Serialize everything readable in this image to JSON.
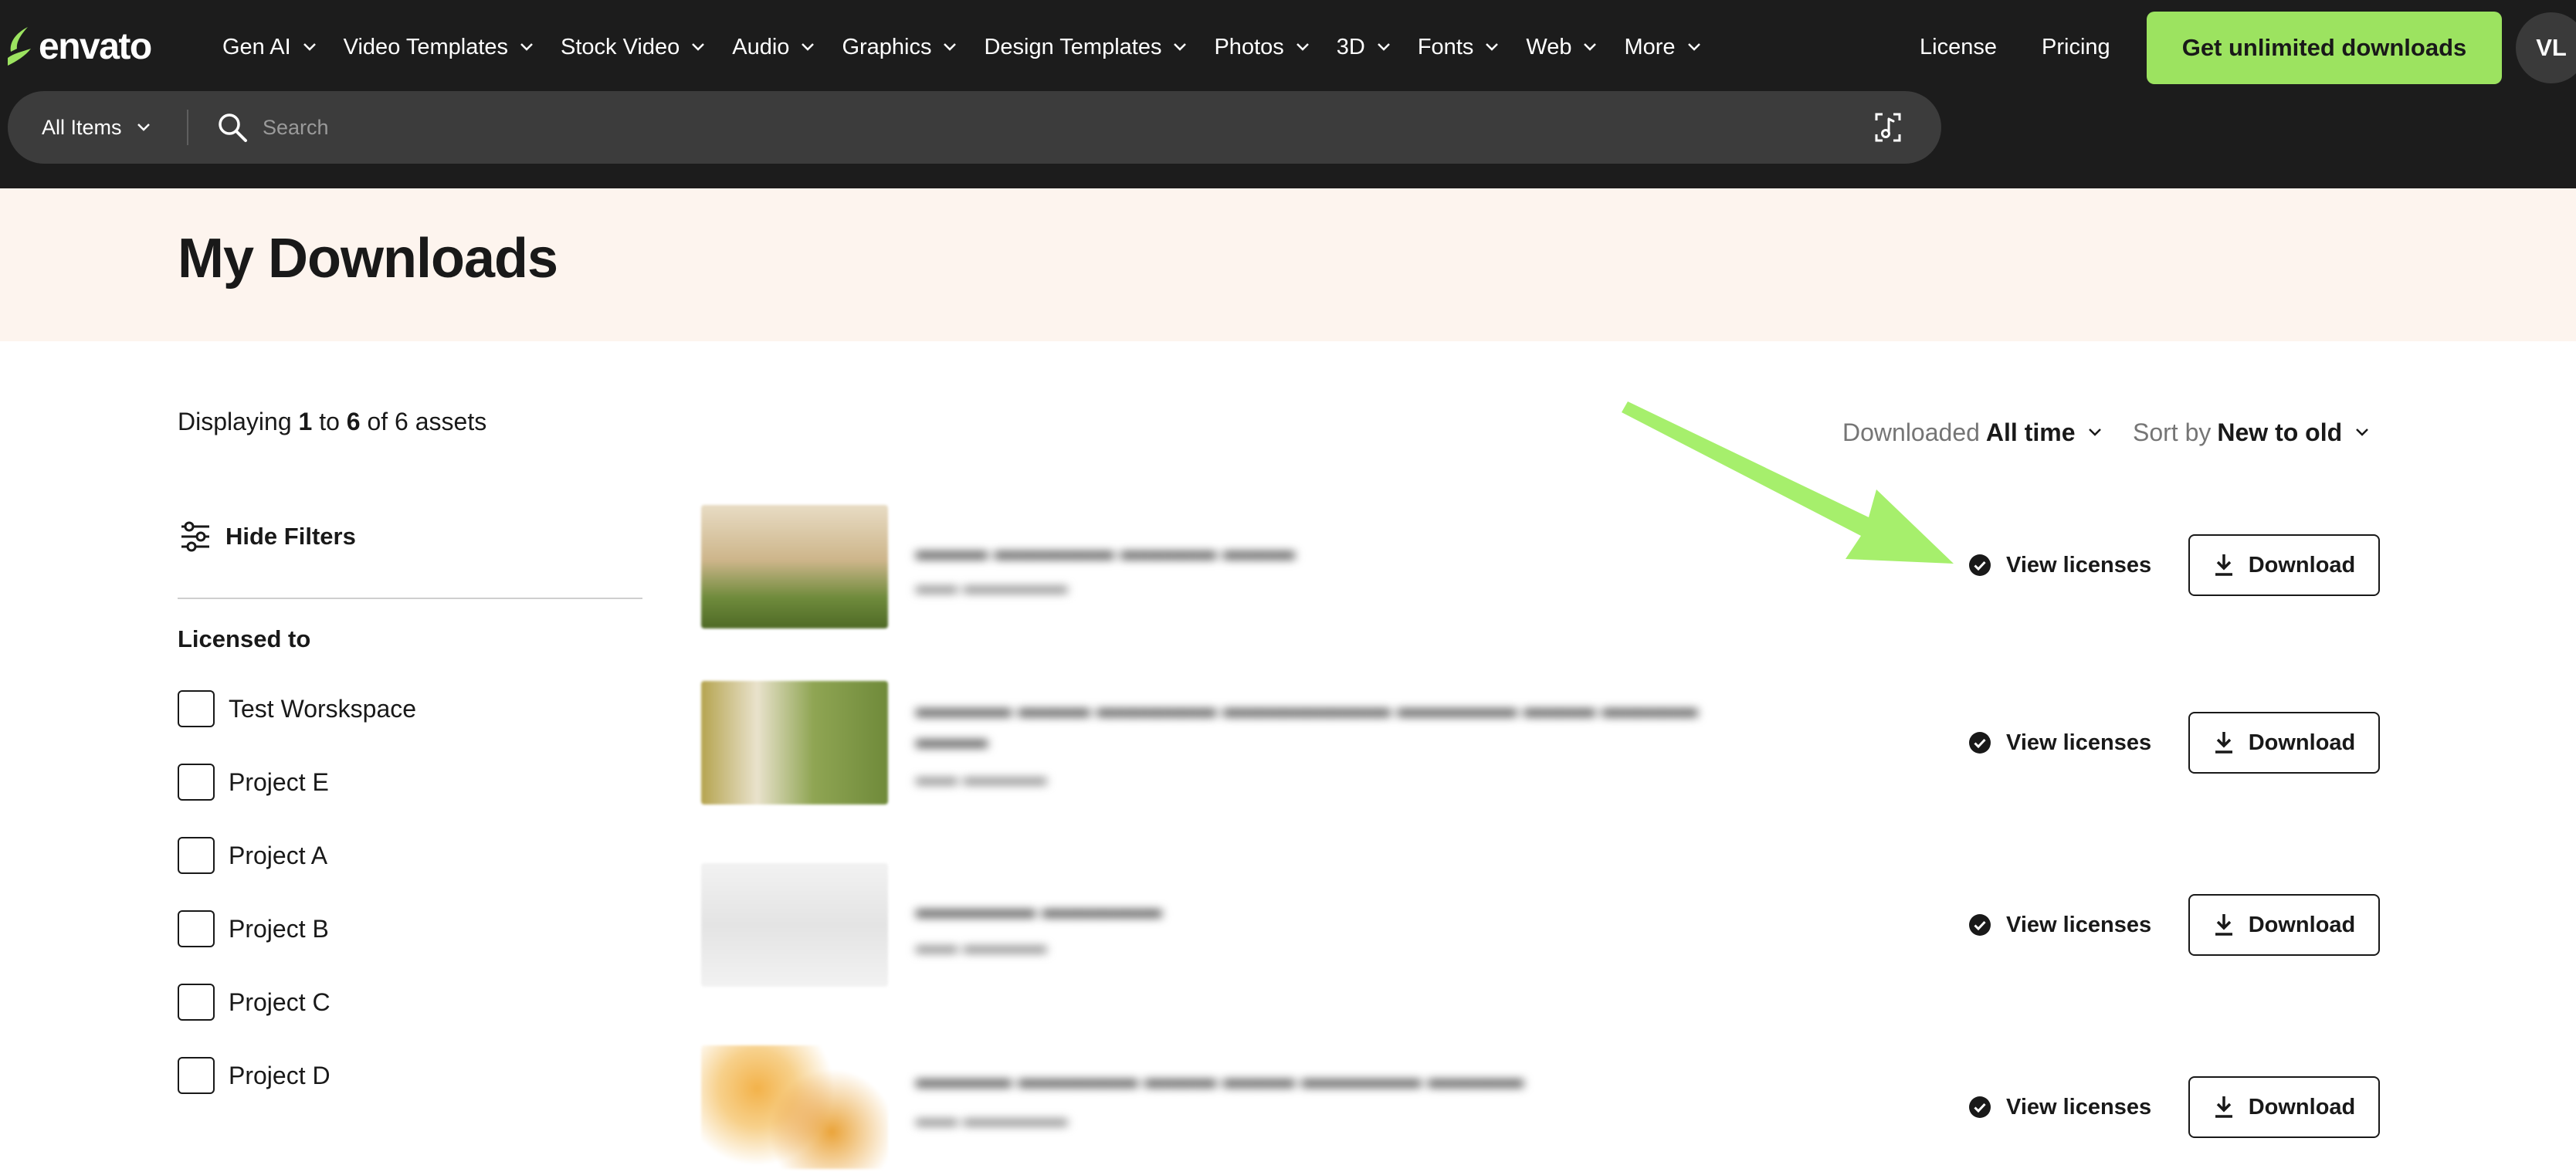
{
  "header": {
    "logo_text": "envato",
    "nav": [
      "Gen AI",
      "Video Templates",
      "Stock Video",
      "Audio",
      "Graphics",
      "Design Templates",
      "Photos",
      "3D",
      "Fonts",
      "Web",
      "More"
    ],
    "license_link": "License",
    "pricing_link": "Pricing",
    "cta_label": "Get unlimited downloads",
    "avatar_initials": "VL",
    "search": {
      "scope_label": "All Items",
      "placeholder": "Search"
    }
  },
  "page": {
    "title": "My Downloads",
    "displaying": {
      "prefix": "Displaying",
      "from": "1",
      "to_word": "to",
      "to": "6",
      "of_word": "of 6 assets"
    },
    "filter_downloaded_label": "Downloaded",
    "filter_downloaded_value": "All time",
    "sort_label": "Sort by",
    "sort_value": "New to old"
  },
  "sidebar": {
    "hide_filters_label": "Hide Filters",
    "licensed_to_title": "Licensed to",
    "options": [
      "Test Worskspace",
      "Project E",
      "Project A",
      "Project B",
      "Project C",
      "Project D"
    ]
  },
  "items": [
    {
      "view_licenses_label": "View licenses",
      "download_label": "Download"
    },
    {
      "view_licenses_label": "View licenses",
      "download_label": "Download"
    },
    {
      "view_licenses_label": "View licenses",
      "download_label": "Download"
    },
    {
      "view_licenses_label": "View licenses",
      "download_label": "Download"
    }
  ],
  "colors": {
    "nav_background": "#1c1c1c",
    "search_background": "#3c3c3c",
    "accent_green": "#9ce360",
    "header_band": "#fdf4ee",
    "annotation_arrow": "#a6ef6c"
  },
  "icons": {
    "logo": "envato-leaf-icon",
    "search": "search-icon",
    "audio_search": "audio-search-icon",
    "filters": "sliders-icon",
    "verified": "verified-check-icon",
    "download": "download-icon",
    "chevron": "chevron-down-icon"
  }
}
